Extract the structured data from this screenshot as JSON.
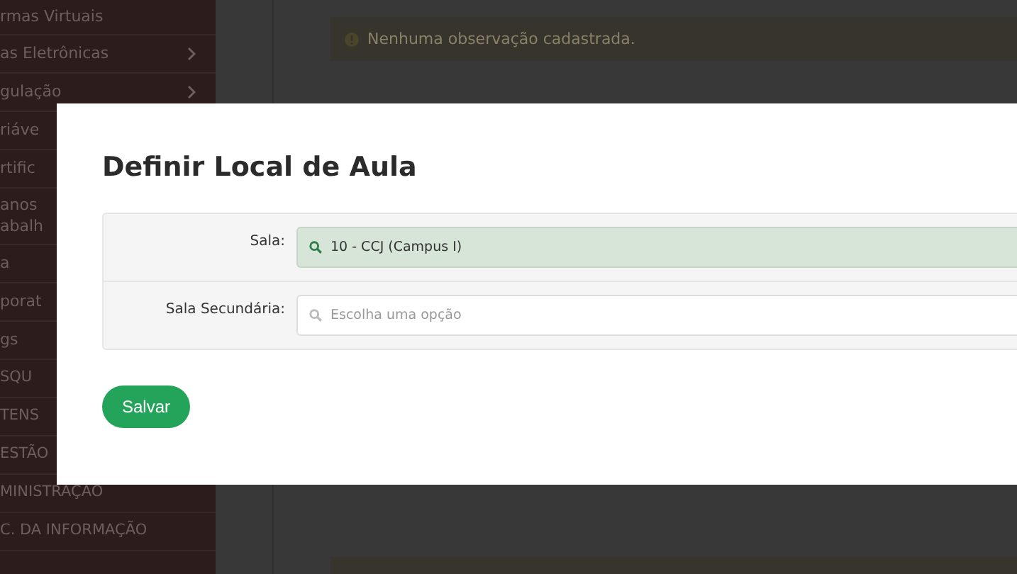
{
  "sidebar": {
    "items": [
      {
        "label": "rmas Virtuais",
        "kind": "link",
        "has_submenu": false
      },
      {
        "label": "as Eletrônicas",
        "kind": "link",
        "has_submenu": true
      },
      {
        "label": "gulação",
        "kind": "link",
        "has_submenu": true
      },
      {
        "label": "riáve",
        "kind": "link"
      },
      {
        "label": "rtific",
        "kind": "link"
      },
      {
        "label": "anos abalh",
        "kind": "link"
      },
      {
        "label": "a",
        "kind": "link"
      },
      {
        "label": "porat",
        "kind": "link"
      },
      {
        "label": "gs",
        "kind": "link"
      },
      {
        "label": "SQU",
        "kind": "section"
      },
      {
        "label": "TENS",
        "kind": "section"
      },
      {
        "label": "ESTÃO",
        "kind": "section"
      },
      {
        "label": "MINISTRAÇÃO",
        "kind": "section",
        "has_submenu": false
      },
      {
        "label": "C. DA INFORMAÇÃO",
        "kind": "section",
        "has_submenu": false
      }
    ]
  },
  "alerts": [
    {
      "text": "Nenhuma observação cadastrada."
    }
  ],
  "modal": {
    "title": "Definir Local de Aula",
    "fields": [
      {
        "label": "Sala:",
        "value": "10 - CCJ (Campus I)",
        "filled": true
      },
      {
        "label": "Sala Secundária:",
        "placeholder": "Escolha uma opção",
        "filled": false
      }
    ],
    "button": "Salvar"
  }
}
